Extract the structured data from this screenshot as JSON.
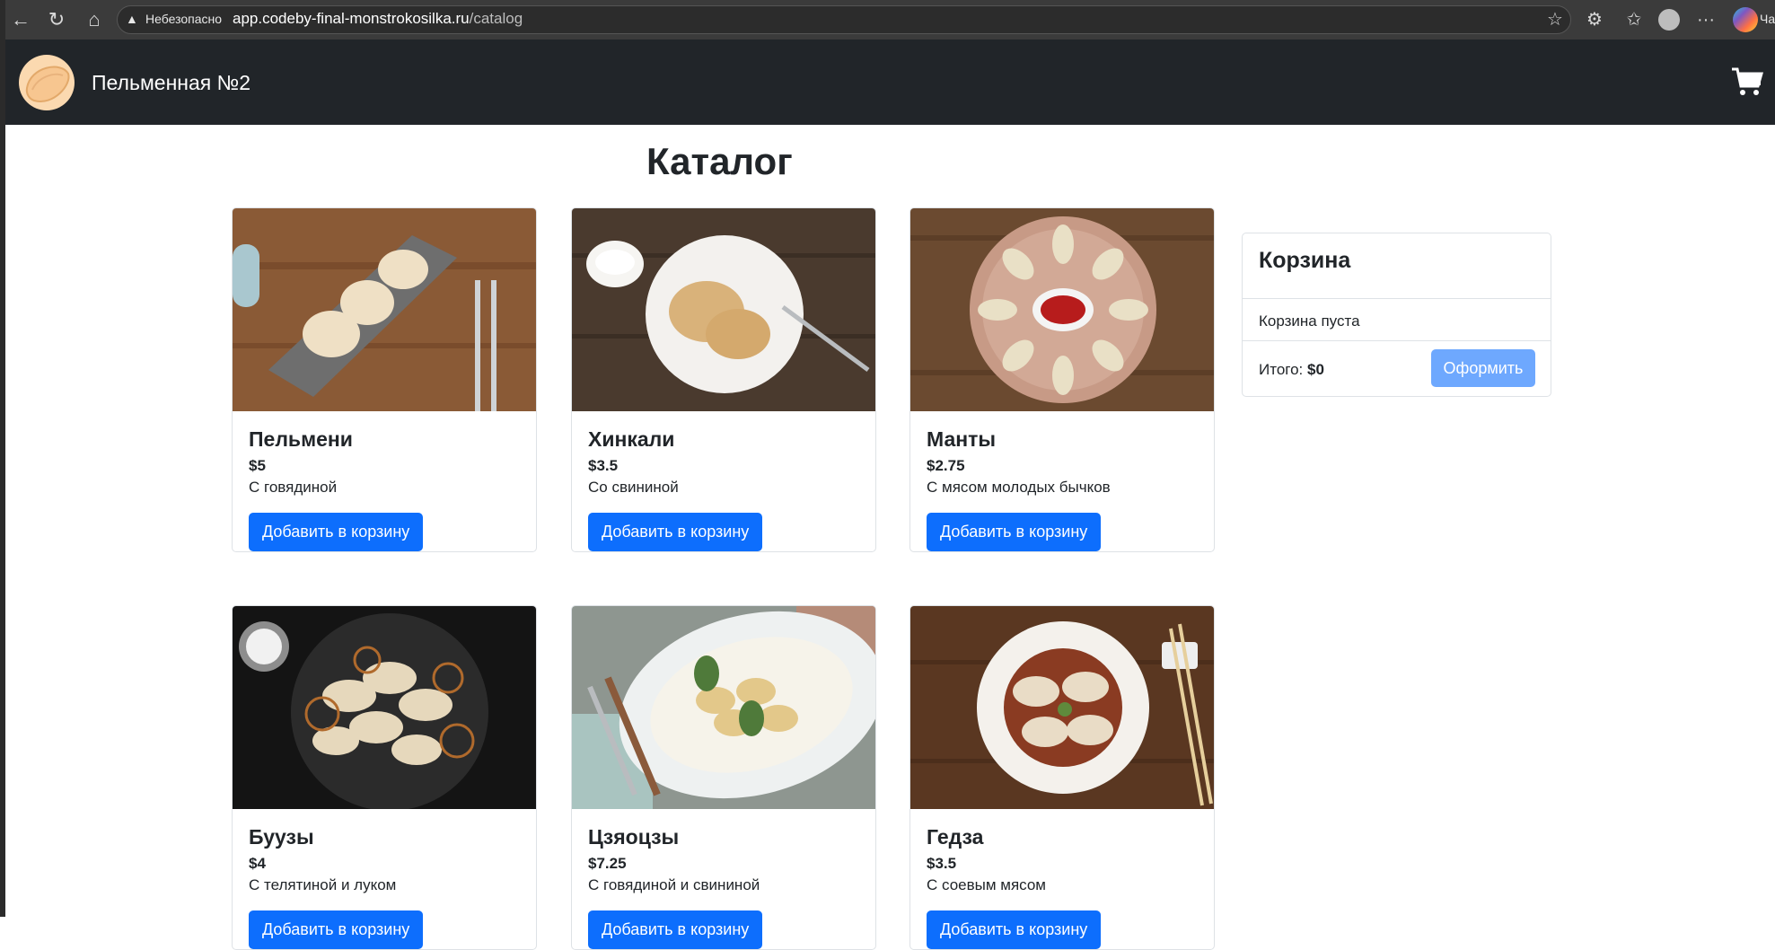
{
  "browser": {
    "warning_label": "Небезопасно",
    "url_host": "app.codeby-final-monstrokosilka.ru",
    "url_path": "/catalog",
    "profile_tail": "Ча"
  },
  "navbar": {
    "brand": "Пельменная №2"
  },
  "catalog": {
    "title": "Каталог",
    "add_label": "Добавить в корзину",
    "items": [
      {
        "name": "Пельмени",
        "price": "$5",
        "desc": "С говядиной"
      },
      {
        "name": "Хинкали",
        "price": "$3.5",
        "desc": "Со свининой"
      },
      {
        "name": "Манты",
        "price": "$2.75",
        "desc": "С мясом молодых бычков"
      },
      {
        "name": "Буузы",
        "price": "$4",
        "desc": "С телятиной и луком"
      },
      {
        "name": "Цзяоцзы",
        "price": "$7.25",
        "desc": "С говядиной и свининой"
      },
      {
        "name": "Гедза",
        "price": "$3.5",
        "desc": "С соевым мясом"
      }
    ]
  },
  "cart": {
    "title": "Корзина",
    "empty_text": "Корзина пуста",
    "total_label": "Итого:",
    "total_value": "$0",
    "checkout_label": "Оформить"
  },
  "colors": {
    "navbar_bg": "#212529",
    "primary": "#0d6efd",
    "primary_disabled": "#6ea8fe"
  }
}
